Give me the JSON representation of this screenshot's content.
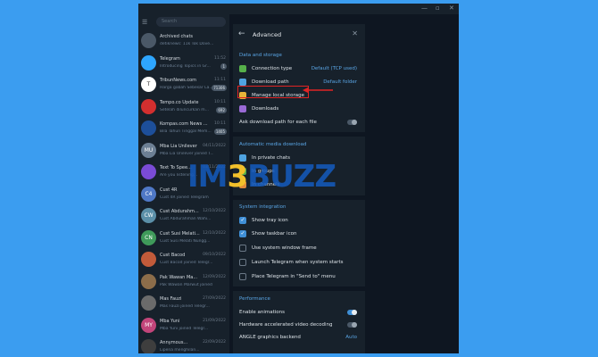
{
  "window": {
    "minimize_icon": "minimize-icon",
    "maximize_icon": "maximize-icon",
    "close_icon": "close-icon"
  },
  "sidebar": {
    "search_placeholder": "Search",
    "chats": [
      {
        "name": "Archived chats",
        "time": "",
        "msg": "detiknews: 11k Tok Dove...",
        "badge": "",
        "avatar": "",
        "color": "#4a5867"
      },
      {
        "name": "Telegram",
        "time": "11:52",
        "msg": "Introducing Topics in Gr...",
        "badge": "1",
        "avatar": "",
        "color": "#2ea6ff"
      },
      {
        "name": "TribunNews.com",
        "time": "11:11",
        "msg": "Harga gabah Sebesar La...",
        "badge": "71306",
        "avatar": "T",
        "color": "#ffffff"
      },
      {
        "name": "Tempo.co Update",
        "time": "10:11",
        "msg": "Setelah diluncurkan m...",
        "badge": "692",
        "avatar": "",
        "color": "#d22f2f"
      },
      {
        "name": "Kompas.com News ...",
        "time": "10:11",
        "msg": "Bila Tahun Tinggal Mem...",
        "badge": "1405",
        "avatar": "",
        "color": "#1d4f9a"
      },
      {
        "name": "Mba Lia Unilever",
        "time": "04/11/2022",
        "msg": "Mba Lia Unilever joined T...",
        "badge": "",
        "avatar": "MU",
        "color": "#6c7f94"
      },
      {
        "name": "Text To Spee...",
        "time": "03/11/2022",
        "msg": "Are you listening...",
        "badge": "",
        "avatar": "",
        "color": "#7a4bd6"
      },
      {
        "name": "Cust 4R",
        "time": "",
        "msg": "Cust 4R joined Telegram",
        "badge": "",
        "avatar": "C4",
        "color": "#4f78c6"
      },
      {
        "name": "Cust Abdurahm...",
        "time": "12/10/2022",
        "msg": "Cust Abdurahman Wahi...",
        "badge": "",
        "avatar": "CW",
        "color": "#5b8fa8"
      },
      {
        "name": "Cust Susi Melati...",
        "time": "12/10/2022",
        "msg": "Cust Susi Melati Nungg...",
        "badge": "",
        "avatar": "CN",
        "color": "#3f9a5a"
      },
      {
        "name": "Cust Bacod",
        "time": "09/10/2022",
        "msg": "Cust Bacod joined Telegr...",
        "badge": "",
        "avatar": "",
        "color": "#c25b3a"
      },
      {
        "name": "Pak Wawan Ma...",
        "time": "12/09/2022",
        "msg": "Pak Wawan Marwut joined T...",
        "badge": "",
        "avatar": "",
        "color": "#8c6d4a"
      },
      {
        "name": "Mas Fauzi",
        "time": "27/09/2022",
        "msg": "Mas Fauzi joined Telegr...",
        "badge": "",
        "avatar": "",
        "color": "#6b6b6b"
      },
      {
        "name": "Mba Yuni",
        "time": "21/09/2022",
        "msg": "Mba Yuni joined Telegr...",
        "badge": "",
        "avatar": "MY",
        "color": "#c2457a"
      },
      {
        "name": "Annymous...",
        "time": "22/09/2022",
        "msg": "Lipena menghilan...",
        "badge": "",
        "avatar": "",
        "color": "#3e3e3e"
      }
    ]
  },
  "panel": {
    "title": "Advanced",
    "section_data": "Data and storage",
    "connection_type": "Connection type",
    "connection_value": "Default (TCP used)",
    "download_path": "Download path",
    "download_value": "Default folder",
    "manage_storage": "Manage local storage",
    "downloads": "Downloads",
    "ask_path": "Ask download path for each file",
    "section_media": "Automatic media download",
    "private_chats": "In private chats",
    "groups": "In groups",
    "channels": "In channels",
    "section_system": "System integration",
    "tray": "Show tray icon",
    "taskbar": "Show taskbar icon",
    "window_frame": "Use system window frame",
    "launch": "Launch Telegram when system starts",
    "send_to": "Place Telegram in \"Send to\" menu",
    "section_perf": "Performance",
    "animations": "Enable animations",
    "hw_video": "Hardware accelerated video decoding",
    "angle": "ANGLE graphics backend",
    "angle_value": "Auto"
  },
  "watermark": {
    "part1": "IM",
    "part2": "3",
    "part3": "BUZZ"
  },
  "colors": {
    "accent": "#5aa6e6",
    "highlight": "#e02424",
    "background": "#3b9df0"
  }
}
